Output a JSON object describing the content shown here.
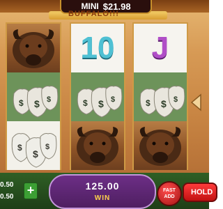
{
  "header": {
    "mini_label": "MINI",
    "mini_value": "$21.98",
    "logo_text": "BUFFALO!!!"
  },
  "reels": [
    {
      "symbols": [
        "buffalo-icon",
        "money-bags-icon",
        "money-bags-icon"
      ]
    },
    {
      "symbols": [
        "ten",
        "money-bags-icon",
        "buffalo-icon"
      ]
    },
    {
      "symbols": [
        "j",
        "money-bags-icon",
        "buffalo-icon"
      ]
    }
  ],
  "symbols": {
    "ten_label": "10",
    "j_label": "J"
  },
  "bottom": {
    "bet_value_1": "0.50",
    "bet_value_2": "0.50",
    "plus_label": "+",
    "win_amount": "125.00",
    "win_label": "WIN",
    "fast_label": "FAST ADD",
    "hold_label": "HOLD"
  },
  "colors": {
    "win_panel": "#5a2470",
    "win_text": "#ffd34a",
    "fast_button": "#d41f1f",
    "hold_button": "#e11b1b",
    "plus_button": "#3c9f34"
  }
}
